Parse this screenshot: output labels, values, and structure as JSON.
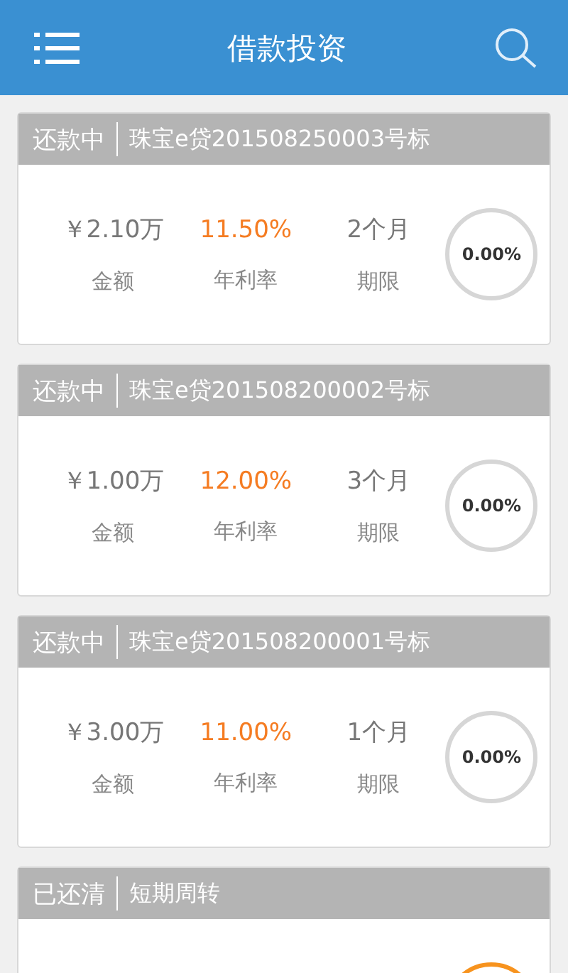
{
  "app_bar": {
    "title": "借款投资"
  },
  "loans": [
    {
      "status": "还款中",
      "name": "珠宝e贷201508250003号标",
      "amount": "￥2.10万",
      "amount_label": "金额",
      "rate": "11.50%",
      "rate_label": "年利率",
      "term": "2个月",
      "term_label": "期限",
      "completed": false,
      "progress": "0.00%"
    },
    {
      "status": "还款中",
      "name": "珠宝e贷201508200002号标",
      "amount": "￥1.00万",
      "amount_label": "金额",
      "rate": "12.00%",
      "rate_label": "年利率",
      "term": "3个月",
      "term_label": "期限",
      "completed": false,
      "progress": "0.00%"
    },
    {
      "status": "还款中",
      "name": "珠宝e贷201508200001号标",
      "amount": "￥3.00万",
      "amount_label": "金额",
      "rate": "11.00%",
      "rate_label": "年利率",
      "term": "1个月",
      "term_label": "期限",
      "completed": false,
      "progress": "0.00%"
    },
    {
      "status": "已还清",
      "name": "短期周转",
      "completed": true
    }
  ]
}
